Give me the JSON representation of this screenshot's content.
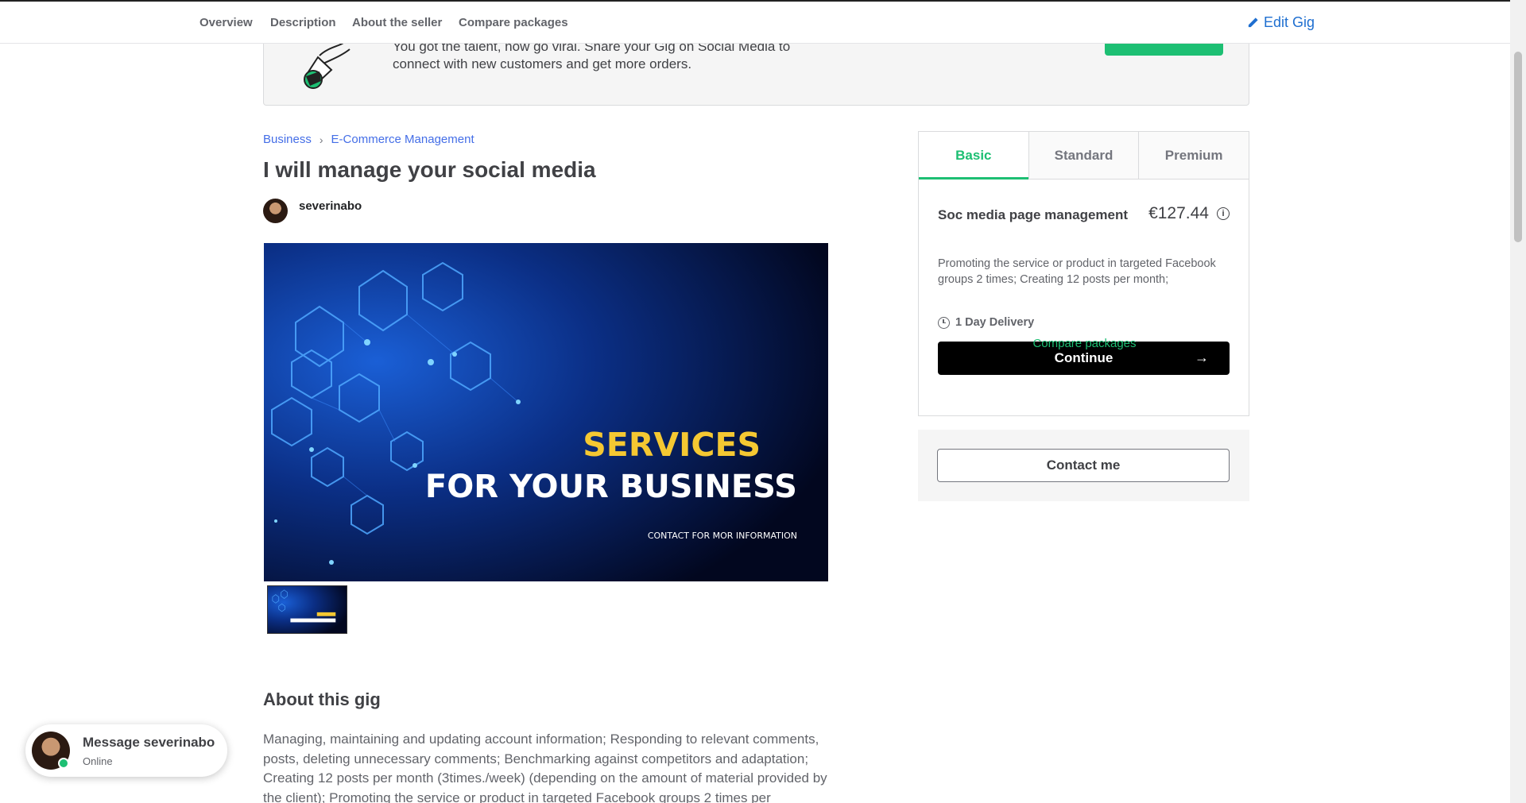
{
  "nav": {
    "links": [
      "Overview",
      "Description",
      "About the seller",
      "Compare packages"
    ],
    "edit_gig": "Edit Gig"
  },
  "banner": {
    "message": "You got the talent, now go viral. Share your Gig on Social Media to connect with new customers and get more orders."
  },
  "breadcrumb": [
    "Business",
    "E-Commerce Management"
  ],
  "gig": {
    "title": "I will manage your social media",
    "seller": "severinabo",
    "image_text": {
      "line1": "SERVICES",
      "line2": "FOR YOUR BUSINESS",
      "line3": "CONTACT FOR MOR INFORMATION"
    }
  },
  "about": {
    "heading": "About this gig",
    "text": "Managing, maintaining and updating account information; Responding to relevant comments, posts, deleting unnecessary comments; Benchmarking against competitors and adaptation; Creating 12 posts per month (3times./week) (depending on the amount of material provided by the client); Promoting the service or product in targeted Facebook groups 2 times per"
  },
  "packages": {
    "tabs": [
      "Basic",
      "Standard",
      "Premium"
    ],
    "active_tab": "Basic",
    "name": "Soc media page management",
    "price": "€127.44",
    "description": "Promoting the service or product in targeted Facebook groups 2 times; Creating 12 posts per month;",
    "delivery": "1 Day Delivery",
    "continue_label": "Continue",
    "compare_label": "Compare packages"
  },
  "contact": {
    "label": "Contact me"
  },
  "message_bubble": {
    "title": "Message severinabo",
    "status": "Online"
  },
  "colors": {
    "brand_green": "#1dbf73",
    "link_blue": "#446ee7",
    "text_dark": "#404145"
  }
}
